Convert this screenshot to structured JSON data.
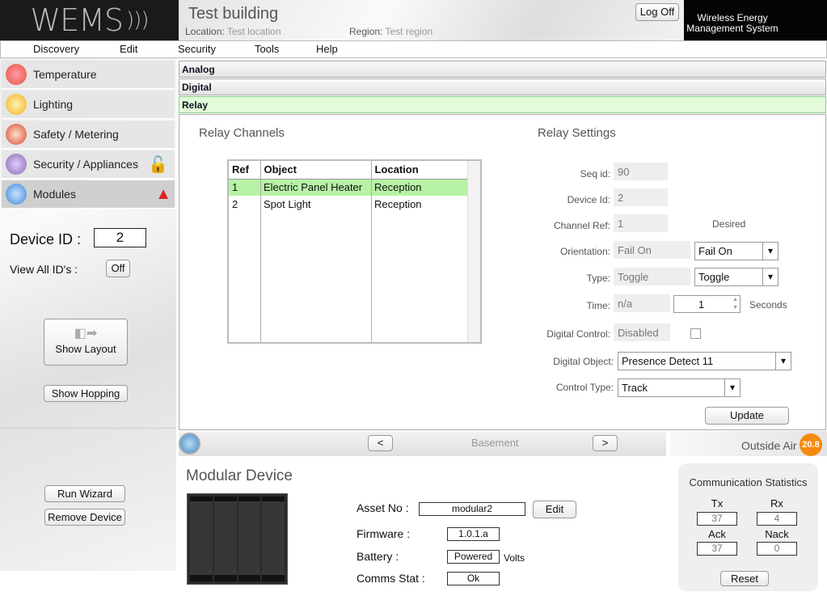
{
  "header": {
    "logo": "WEMS",
    "building": "Test building",
    "location_label": "Location:",
    "location": "Test location",
    "region_label": "Region:",
    "region": "Test region",
    "logoff": "Log Off",
    "brand": "Wireless Energy Management System"
  },
  "menu": [
    "Discovery",
    "Edit",
    "Security",
    "Tools",
    "Help"
  ],
  "sidebar": {
    "items": [
      {
        "label": "Temperature",
        "color": "#e8553a"
      },
      {
        "label": "Lighting",
        "color": "#f0b020"
      },
      {
        "label": "Safety / Metering",
        "color": "#d84a30"
      },
      {
        "label": "Security / Appliances",
        "color": "#8a6ab0"
      },
      {
        "label": "Modules",
        "color": "#3a8ad8"
      }
    ],
    "device_id_label": "Device ID :",
    "device_id": "2",
    "view_all_label": "View All ID's :",
    "view_all": "Off",
    "show_layout": "Show Layout",
    "show_hopping": "Show Hopping",
    "run_wizard": "Run Wizard",
    "remove_device": "Remove Device"
  },
  "sections": [
    "Analog",
    "Digital",
    "Relay"
  ],
  "relay_channels": {
    "title": "Relay Channels",
    "columns": [
      "Ref",
      "Object",
      "Location"
    ],
    "rows": [
      [
        "1",
        "Electric Panel Heater",
        "Reception"
      ],
      [
        "2",
        "Spot Light",
        "Reception"
      ]
    ]
  },
  "relay_settings": {
    "title": "Relay Settings",
    "seq_label": "Seq id:",
    "seq": "90",
    "device_label": "Device Id:",
    "device": "2",
    "channel_label": "Channel Ref:",
    "channel": "1",
    "desired": "Desired",
    "orientation_label": "Orientation:",
    "orientation": "Fail On",
    "orientation_sel": "Fail On",
    "type_label": "Type:",
    "type": "Toggle",
    "type_sel": "Toggle",
    "time_label": "Time:",
    "time": "n/a",
    "time_val": "1",
    "seconds": "Seconds",
    "dc_label": "Digital Control:",
    "dc": "Disabled",
    "do_label": "Digital Object:",
    "do": "Presence Detect 11",
    "ct_label": "Control Type:",
    "ct": "Track",
    "update": "Update"
  },
  "nav": {
    "prev": "<",
    "floor": "Basement",
    "next": ">",
    "outside_label": "Outside Air",
    "outside": "20.8"
  },
  "device": {
    "title": "Modular Device",
    "asset_label": "Asset No :",
    "asset": "modular2",
    "edit": "Edit",
    "fw_label": "Firmware :",
    "fw": "1.0.1.a",
    "bat_label": "Battery :",
    "bat": "Powered",
    "volts": "Volts",
    "comms_label": "Comms Stat :",
    "comms": "Ok"
  },
  "stats": {
    "title": "Communication Statistics",
    "tx_label": "Tx",
    "tx": "37",
    "rx_label": "Rx",
    "rx": "4",
    "ack_label": "Ack",
    "ack": "37",
    "nack_label": "Nack",
    "nack": "0",
    "reset": "Reset"
  }
}
